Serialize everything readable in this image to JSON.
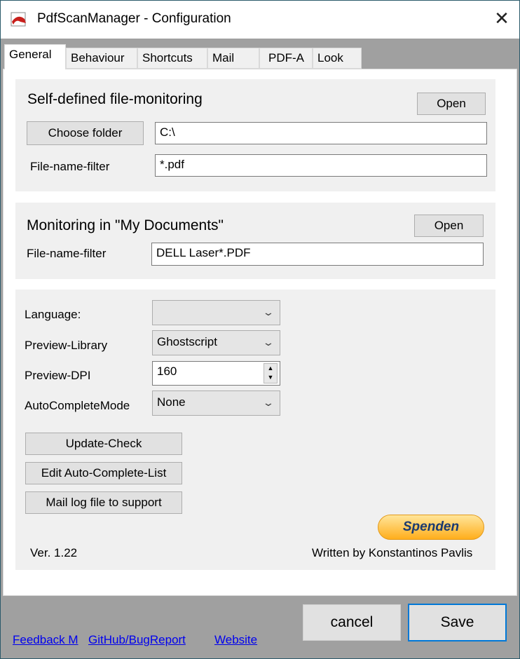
{
  "window": {
    "title": "PdfScanManager - Configuration"
  },
  "tabs": [
    {
      "label": "General"
    },
    {
      "label": "Behaviour"
    },
    {
      "label": "Shortcuts"
    },
    {
      "label": "Mail"
    },
    {
      "label": "PDF-A"
    },
    {
      "label": "Look"
    }
  ],
  "self_monitoring": {
    "heading": "Self-defined file-monitoring",
    "open_label": "Open",
    "choose_folder_label": "Choose folder",
    "folder_value": "C:\\",
    "filter_label": "File-name-filter",
    "filter_value": "*.pdf"
  },
  "docs_monitoring": {
    "heading": "Monitoring in \"My Documents\"",
    "open_label": "Open",
    "filter_label": "File-name-filter",
    "filter_value": "DELL Laser*.PDF"
  },
  "settings": {
    "language_label": "Language:",
    "language_value": "",
    "preview_library_label": "Preview-Library",
    "preview_library_value": "Ghostscript",
    "preview_dpi_label": "Preview-DPI",
    "preview_dpi_value": "160",
    "autocomplete_label": "AutoCompleteMode",
    "autocomplete_value": "None",
    "update_check_label": "Update-Check",
    "edit_autocomplete_label": "Edit Auto-Complete-List",
    "mail_log_label": "Mail log file to support",
    "donate_label": "Spenden",
    "version": "Ver. 1.22",
    "author": "Written by Konstantinos Pavlis"
  },
  "footer": {
    "links": [
      {
        "label": "Feedback M"
      },
      {
        "label": "GitHub/BugReport"
      },
      {
        "label": "Website"
      }
    ],
    "cancel_label": "cancel",
    "save_label": "Save"
  },
  "colors": {
    "accent": "#0078d7",
    "link": "#0000ee",
    "donate": "#ffae1c"
  }
}
